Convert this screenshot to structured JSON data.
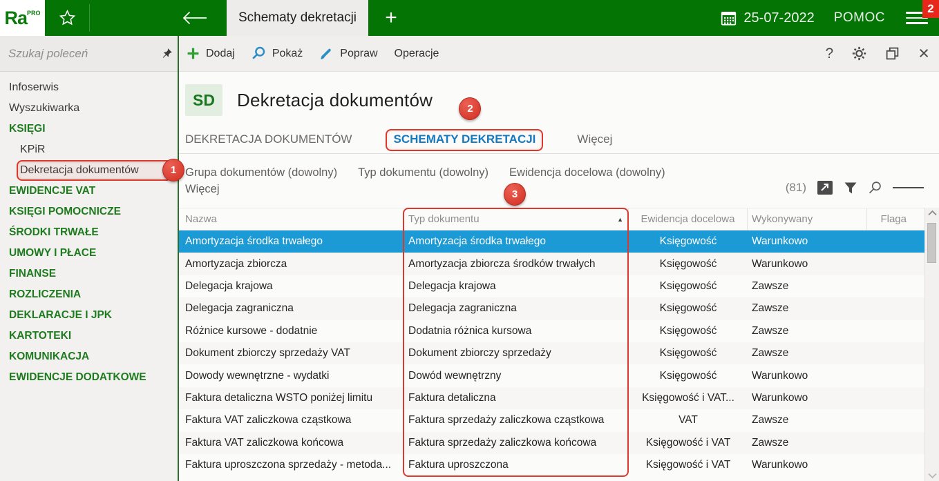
{
  "topbar": {
    "logo": "Ra",
    "logo_sup": "PRO",
    "active_tab": "Schematy dekretacji",
    "date": "25-07-2022",
    "help_label": "POMOC",
    "notification_badge": "2"
  },
  "sidebar": {
    "search_placeholder": "Szukaj poleceń",
    "items": [
      {
        "label": "Infoserwis",
        "type": "item"
      },
      {
        "label": "Wyszukiwarka",
        "type": "item"
      },
      {
        "label": "KSIĘGI",
        "type": "section"
      },
      {
        "label": "KPiR",
        "type": "sub"
      },
      {
        "label": "Dekretacja dokumentów",
        "type": "sub",
        "annotation_badge": "1"
      },
      {
        "label": "EWIDENCJE VAT",
        "type": "section"
      },
      {
        "label": "KSIĘGI POMOCNICZE",
        "type": "section"
      },
      {
        "label": "ŚRODKI TRWAŁE",
        "type": "section"
      },
      {
        "label": "UMOWY I PŁACE",
        "type": "section"
      },
      {
        "label": "FINANSE",
        "type": "section"
      },
      {
        "label": "ROZLICZENIA",
        "type": "section"
      },
      {
        "label": "DEKLARACJE I JPK",
        "type": "section"
      },
      {
        "label": "KARTOTEKI",
        "type": "section"
      },
      {
        "label": "KOMUNIKACJA",
        "type": "section"
      },
      {
        "label": "EWIDENCJE DODATKOWE",
        "type": "section"
      }
    ]
  },
  "toolbar": {
    "buttons": [
      {
        "label": "Dodaj",
        "icon": "plus-icon"
      },
      {
        "label": "Pokaż",
        "icon": "magnifier-icon"
      },
      {
        "label": "Popraw",
        "icon": "brush-icon"
      },
      {
        "label": "Operacje",
        "icon": null
      }
    ],
    "window_icons": [
      "help-icon",
      "gear-icon",
      "restore-window-icon",
      "close-icon"
    ]
  },
  "header": {
    "module_code": "SD",
    "title": "Dekretacja dokumentów"
  },
  "tabs": [
    {
      "label": "DEKRETACJA DOKUMENTÓW",
      "active": false
    },
    {
      "label": "SCHEMATY DEKRETACJI",
      "active": true,
      "annotation_badge": "2"
    },
    {
      "label": "Więcej",
      "active": false
    }
  ],
  "filters": {
    "items": [
      "Grupa dokumentów (dowolny)",
      "Typ dokumentu (dowolny)",
      "Ewidencja docelowa (dowolny)"
    ],
    "more": "Więcej",
    "count": "(81)",
    "annotation_badge": "3",
    "icons": [
      "export-icon",
      "filter-funnel-icon",
      "search-icon",
      "list-options-icon"
    ]
  },
  "table": {
    "columns": [
      "Nazwa",
      "Typ dokumentu",
      "Ewidencja docelowa",
      "Wykonywany",
      "Flaga"
    ],
    "sort": {
      "column": "Typ dokumentu",
      "direction": "asc",
      "glyph": "▲"
    },
    "rows": [
      {
        "name": "Amortyzacja środka trwałego",
        "doc_type": "Amortyzacja środka trwałego",
        "target": "Księgowość",
        "executed": "Warunkowo",
        "flag": "",
        "selected": true
      },
      {
        "name": "Amortyzacja zbiorcza",
        "doc_type": "Amortyzacja zbiorcza środków trwałych",
        "target": "Księgowość",
        "executed": "Warunkowo",
        "flag": ""
      },
      {
        "name": "Delegacja krajowa",
        "doc_type": "Delegacja krajowa",
        "target": "Księgowość",
        "executed": "Zawsze",
        "flag": ""
      },
      {
        "name": "Delegacja zagraniczna",
        "doc_type": "Delegacja zagraniczna",
        "target": "Księgowość",
        "executed": "Zawsze",
        "flag": ""
      },
      {
        "name": "Różnice kursowe - dodatnie",
        "doc_type": "Dodatnia różnica kursowa",
        "target": "Księgowość",
        "executed": "Zawsze",
        "flag": ""
      },
      {
        "name": "Dokument zbiorczy sprzedaży VAT",
        "doc_type": "Dokument zbiorczy sprzedaży",
        "target": "Księgowość",
        "executed": "Zawsze",
        "flag": ""
      },
      {
        "name": "Dowody wewnętrzne - wydatki",
        "doc_type": "Dowód wewnętrzny",
        "target": "Księgowość",
        "executed": "Warunkowo",
        "flag": ""
      },
      {
        "name": "Faktura detaliczna WSTO poniżej limitu",
        "doc_type": "Faktura detaliczna",
        "target": "Księgowość i VAT...",
        "executed": "Warunkowo",
        "flag": ""
      },
      {
        "name": "Faktura VAT zaliczkowa cząstkowa",
        "doc_type": "Faktura sprzedaży zaliczkowa cząstkowa",
        "target": "VAT",
        "executed": "Zawsze",
        "flag": ""
      },
      {
        "name": "Faktura VAT zaliczkowa końcowa",
        "doc_type": "Faktura sprzedaży zaliczkowa końcowa",
        "target": "Księgowość i VAT",
        "executed": "Zawsze",
        "flag": ""
      },
      {
        "name": "Faktura uproszczona sprzedaży - metoda...",
        "doc_type": "Faktura uproszczona",
        "target": "Księgowość i VAT",
        "executed": "Warunkowo",
        "flag": ""
      }
    ]
  },
  "colors": {
    "topbar_green": "#047404",
    "accent_green": "#1e7b1e",
    "selection_blue": "#1b9ad6",
    "active_tab_blue": "#1678bd",
    "annotation_red": "#da392c"
  },
  "icons_glossary": {
    "favorites": "star-outline",
    "back": "left-arrow",
    "new_tab": "plus",
    "date": "calendar-grid",
    "menu": "hamburger",
    "sidebar_pin": "pushpin",
    "sort_asc": "▲"
  }
}
